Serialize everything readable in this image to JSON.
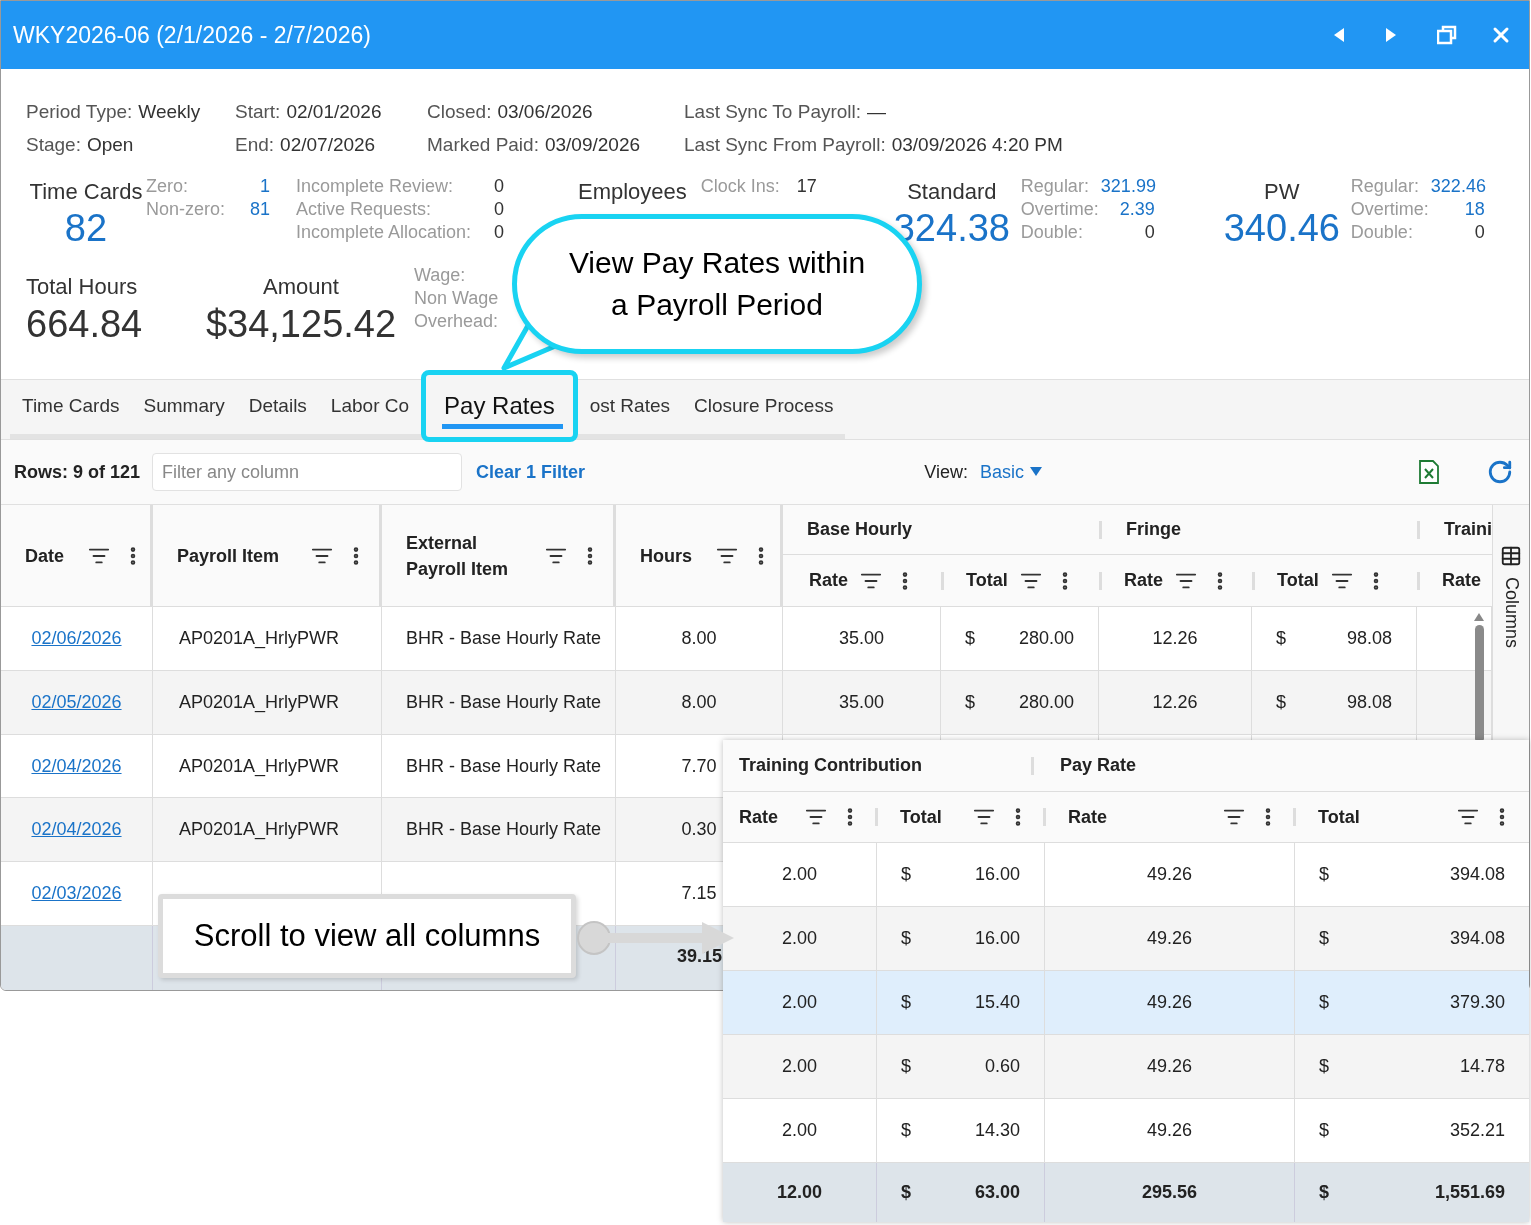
{
  "window": {
    "title": "WKY2026-06 (2/1/2026 - 2/7/2026)"
  },
  "period_info": [
    [
      {
        "label": "Period Type:",
        "value": "Weekly"
      },
      {
        "label": "Start:",
        "value": "02/01/2026"
      },
      {
        "label": "Closed:",
        "value": "03/06/2026"
      },
      {
        "label": "Last Sync To Payroll:",
        "value": "—"
      }
    ],
    [
      {
        "label": "Stage:",
        "value": "Open"
      },
      {
        "label": "End:",
        "value": "02/07/2026"
      },
      {
        "label": "Marked Paid:",
        "value": "03/09/2026"
      },
      {
        "label": "Last Sync From Payroll:",
        "value": "03/09/2026 4:20 PM"
      }
    ]
  ],
  "time_cards": {
    "title": "Time Cards",
    "value": "82",
    "breakdown": [
      {
        "label": "Zero:",
        "value": "1",
        "emphasis": true
      },
      {
        "label": "Non-zero:",
        "value": "81",
        "emphasis": true
      }
    ],
    "issues": [
      {
        "label": "Incomplete Review:",
        "value": "0"
      },
      {
        "label": "Active Requests:",
        "value": "0"
      },
      {
        "label": "Incomplete Allocation:",
        "value": "0"
      }
    ]
  },
  "employees": {
    "title": "Employees",
    "breakdown": [
      {
        "label": "Clock Ins:",
        "value": "17"
      }
    ]
  },
  "hour_groups": [
    {
      "title": "Standard",
      "value": "324.38",
      "breakdown": [
        {
          "label": "Regular:",
          "value": "321.99",
          "emphasis": true
        },
        {
          "label": "Overtime:",
          "value": "2.39",
          "emphasis": true
        },
        {
          "label": "Double:",
          "value": "0",
          "emphasis": false
        }
      ]
    },
    {
      "title": "PW",
      "value": "340.46",
      "breakdown": [
        {
          "label": "Regular:",
          "value": "322.46",
          "emphasis": true
        },
        {
          "label": "Overtime:",
          "value": "18",
          "emphasis": true
        },
        {
          "label": "Double:",
          "value": "0",
          "emphasis": false
        }
      ]
    }
  ],
  "total_hours": {
    "title": "Total Hours",
    "value": "664.84"
  },
  "amount": {
    "title": "Amount",
    "value": "$34,125.42",
    "breakdown": [
      "Wage:",
      "Non Wage",
      "Overhead:"
    ]
  },
  "tabs": [
    {
      "label": "Time Cards",
      "selected": false
    },
    {
      "label": "Summary",
      "selected": false
    },
    {
      "label": "Details",
      "selected": false
    },
    {
      "label": "Labor Co",
      "selected": false
    },
    {
      "label": "Pay Rates",
      "selected": true
    },
    {
      "label": "ost Rates",
      "selected": false
    },
    {
      "label": "Closure Process",
      "selected": false
    }
  ],
  "toolbar": {
    "rows": "Rows: 9 of 121",
    "filter_placeholder": "Filter any column",
    "clear_filter": "Clear 1 Filter",
    "view_label": "View:",
    "view_value": "Basic"
  },
  "table": {
    "columns": [
      "Date",
      "Payroll Item",
      "External Payroll Item",
      "Hours"
    ],
    "groups": [
      {
        "title": "Base Hourly",
        "columns": [
          "Rate",
          "Total"
        ]
      },
      {
        "title": "Fringe",
        "columns": [
          "Rate",
          "Total"
        ]
      },
      {
        "title": "Traini",
        "columns": [
          "Rate"
        ]
      }
    ],
    "rows": [
      {
        "date": "02/06/2026",
        "payroll_item": "AP0201A_HrlyPWR",
        "external": "BHR - Base Hourly Rate",
        "hours": "8.00",
        "base_rate": "35.00",
        "base_total": {
          "symbol": "$",
          "amount": "280.00"
        },
        "fringe_rate": "12.26",
        "fringe_total": {
          "symbol": "$",
          "amount": "98.08"
        }
      },
      {
        "date": "02/05/2026",
        "payroll_item": "AP0201A_HrlyPWR",
        "external": "BHR - Base Hourly Rate",
        "hours": "8.00",
        "base_rate": "35.00",
        "base_total": {
          "symbol": "$",
          "amount": "280.00"
        },
        "fringe_rate": "12.26",
        "fringe_total": {
          "symbol": "$",
          "amount": "98.08"
        }
      },
      {
        "date": "02/04/2026",
        "payroll_item": "AP0201A_HrlyPWR",
        "external": "BHR - Base Hourly Rate",
        "hours": "7.70"
      },
      {
        "date": "02/04/2026",
        "payroll_item": "AP0201A_HrlyPWR",
        "external": "BHR - Base Hourly Rate",
        "hours": "0.30"
      },
      {
        "date": "02/03/2026",
        "hours": "7.15"
      }
    ],
    "totals": {
      "hours": "39.15"
    }
  },
  "side_panel": {
    "label": "Columns"
  },
  "inset_table": {
    "groups": [
      {
        "title": "Training Contribution",
        "columns": [
          "Rate",
          "Total"
        ]
      },
      {
        "title": "Pay Rate",
        "columns": [
          "Rate",
          "Total"
        ]
      }
    ],
    "rows": [
      {
        "training_rate": "2.00",
        "training_total": {
          "symbol": "$",
          "amount": "16.00"
        },
        "pay_rate": "49.26",
        "pay_total": {
          "symbol": "$",
          "amount": "394.08"
        },
        "selected": false
      },
      {
        "training_rate": "2.00",
        "training_total": {
          "symbol": "$",
          "amount": "16.00"
        },
        "pay_rate": "49.26",
        "pay_total": {
          "symbol": "$",
          "amount": "394.08"
        },
        "selected": false
      },
      {
        "training_rate": "2.00",
        "training_total": {
          "symbol": "$",
          "amount": "15.40"
        },
        "pay_rate": "49.26",
        "pay_total": {
          "symbol": "$",
          "amount": "379.30"
        },
        "selected": true
      },
      {
        "training_rate": "2.00",
        "training_total": {
          "symbol": "$",
          "amount": "0.60"
        },
        "pay_rate": "49.26",
        "pay_total": {
          "symbol": "$",
          "amount": "14.78"
        },
        "selected": false
      },
      {
        "training_rate": "2.00",
        "training_total": {
          "symbol": "$",
          "amount": "14.30"
        },
        "pay_rate": "49.26",
        "pay_total": {
          "symbol": "$",
          "amount": "352.21"
        },
        "selected": false
      }
    ],
    "totals": {
      "training_rate": "12.00",
      "training_total": {
        "symbol": "$",
        "amount": "63.00"
      },
      "pay_rate": "295.56",
      "pay_total": {
        "symbol": "$",
        "amount": "1,551.69"
      }
    }
  },
  "callouts": [
    {
      "kind": "bubble",
      "text": "View Pay Rates within a Payroll Period"
    },
    {
      "kind": "note",
      "text": "Scroll to view all columns"
    }
  ]
}
